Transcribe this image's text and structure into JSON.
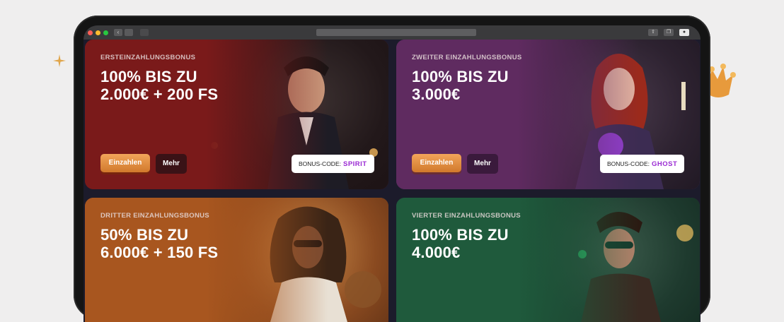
{
  "colors": {
    "background": "#efeeee",
    "card1": "#7a1c1c",
    "card2": "#5c2a5e",
    "card3": "#a8551f",
    "card4": "#1f5a3c",
    "button_orange": "#e58b3b",
    "code_accent": "#9a2ad3"
  },
  "icons": {
    "decor_left": "sparkle-icon",
    "decor_right": "crown-icon"
  },
  "cards": [
    {
      "label": "ERSTEINZAHLUNGSBONUS",
      "line1": "100% BIS ZU",
      "line2": "2.000€ + 200 FS",
      "primary_button": "Einzahlen",
      "secondary_button": "Mehr",
      "code_label": "BONUS-CODE:",
      "code_value": "SPIRIT"
    },
    {
      "label": "ZWEITER EINZAHLUNGSBONUS",
      "line1": "100% BIS ZU",
      "line2": "3.000€",
      "primary_button": "Einzahlen",
      "secondary_button": "Mehr",
      "code_label": "BONUS-CODE:",
      "code_value": "GHOST"
    },
    {
      "label": "DRITTER EINZAHLUNGSBONUS",
      "line1": "50% BIS ZU",
      "line2": "6.000€ + 150 FS"
    },
    {
      "label": "VIERTER EINZAHLUNGSBONUS",
      "line1": "100% BIS ZU",
      "line2": "4.000€"
    }
  ]
}
